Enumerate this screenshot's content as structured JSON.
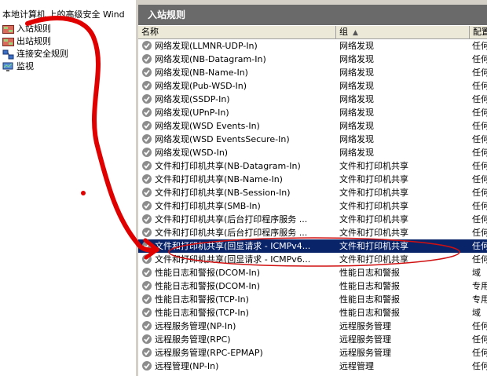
{
  "left_pane": {
    "title": "本地计算机 上的高级安全 Wind",
    "items": [
      {
        "label": "入站规则",
        "icon": "inbound-rules-icon"
      },
      {
        "label": "出站规则",
        "icon": "outbound-rules-icon"
      },
      {
        "label": "连接安全规则",
        "icon": "connection-security-icon"
      },
      {
        "label": "监视",
        "icon": "monitor-icon"
      }
    ]
  },
  "right_pane": {
    "title": "入站规则",
    "columns": [
      "名称",
      "组",
      "配置"
    ],
    "rows": [
      {
        "name": "网络发现(LLMNR-UDP-In)",
        "group": "网络发现",
        "profile": "任何"
      },
      {
        "name": "网络发现(NB-Datagram-In)",
        "group": "网络发现",
        "profile": "任何"
      },
      {
        "name": "网络发现(NB-Name-In)",
        "group": "网络发现",
        "profile": "任何"
      },
      {
        "name": "网络发现(Pub-WSD-In)",
        "group": "网络发现",
        "profile": "任何"
      },
      {
        "name": "网络发现(SSDP-In)",
        "group": "网络发现",
        "profile": "任何"
      },
      {
        "name": "网络发现(UPnP-In)",
        "group": "网络发现",
        "profile": "任何"
      },
      {
        "name": "网络发现(WSD Events-In)",
        "group": "网络发现",
        "profile": "任何"
      },
      {
        "name": "网络发现(WSD EventsSecure-In)",
        "group": "网络发现",
        "profile": "任何"
      },
      {
        "name": "网络发现(WSD-In)",
        "group": "网络发现",
        "profile": "任何"
      },
      {
        "name": "文件和打印机共享(NB-Datagram-In)",
        "group": "文件和打印机共享",
        "profile": "任何"
      },
      {
        "name": "文件和打印机共享(NB-Name-In)",
        "group": "文件和打印机共享",
        "profile": "任何"
      },
      {
        "name": "文件和打印机共享(NB-Session-In)",
        "group": "文件和打印机共享",
        "profile": "任何"
      },
      {
        "name": "文件和打印机共享(SMB-In)",
        "group": "文件和打印机共享",
        "profile": "任何"
      },
      {
        "name": "文件和打印机共享(后台打印程序服务 ...",
        "group": "文件和打印机共享",
        "profile": "任何"
      },
      {
        "name": "文件和打印机共享(后台打印程序服务 ...",
        "group": "文件和打印机共享",
        "profile": "任何"
      },
      {
        "name": "文件和打印机共享(回显请求 - ICMPv4...",
        "group": "文件和打印机共享",
        "profile": "任何",
        "selected": true
      },
      {
        "name": "文件和打印机共享(回显请求 - ICMPv6...",
        "group": "文件和打印机共享",
        "profile": "任何"
      },
      {
        "name": "性能日志和警报(DCOM-In)",
        "group": "性能日志和警报",
        "profile": "域"
      },
      {
        "name": "性能日志和警报(DCOM-In)",
        "group": "性能日志和警报",
        "profile": "专用"
      },
      {
        "name": "性能日志和警报(TCP-In)",
        "group": "性能日志和警报",
        "profile": "专用"
      },
      {
        "name": "性能日志和警报(TCP-In)",
        "group": "性能日志和警报",
        "profile": "域"
      },
      {
        "name": "远程服务管理(NP-In)",
        "group": "远程服务管理",
        "profile": "任何"
      },
      {
        "name": "远程服务管理(RPC)",
        "group": "远程服务管理",
        "profile": "任何"
      },
      {
        "name": "远程服务管理(RPC-EPMAP)",
        "group": "远程服务管理",
        "profile": "任何"
      },
      {
        "name": "远程管理(NP-In)",
        "group": "远程管理",
        "profile": "任何"
      }
    ]
  },
  "colors": {
    "selection": "#0a246a",
    "annotation": "#e00000",
    "title_bar": "#6a6a6a"
  }
}
